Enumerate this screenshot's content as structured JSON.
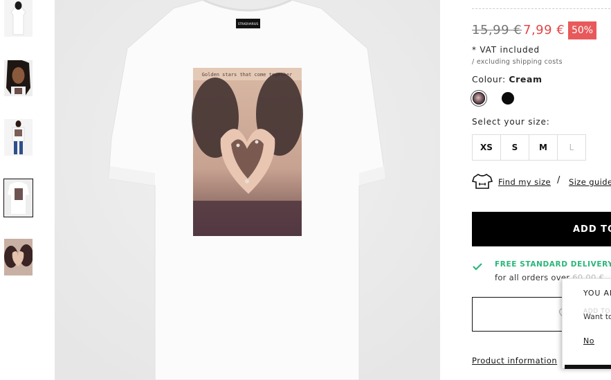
{
  "gallery": {
    "thumbnails": [
      "thumb-1",
      "thumb-2",
      "thumb-3",
      "thumb-4",
      "thumb-5"
    ],
    "selected_index": 3
  },
  "product": {
    "print_caption": "Golden stars that come together",
    "label_text": "STRADIVARIUS"
  },
  "price": {
    "old": "15,99 €",
    "new": "7,99 €",
    "discount": "50%",
    "vat": "* VAT included",
    "shipping_note": "/ excluding shipping costs"
  },
  "colour": {
    "label": "Colour:",
    "value": "Cream",
    "swatches": [
      "cream-print",
      "black"
    ]
  },
  "size": {
    "label": "Select your size:",
    "options": [
      "XS",
      "S",
      "M",
      "L"
    ],
    "unavailable": [
      "L"
    ],
    "find_my_size": "Find my size",
    "separator": "/",
    "size_guide": "Size guide"
  },
  "cart": {
    "add_label": "ADD TO"
  },
  "delivery": {
    "free_label": "FREE STANDARD DELIVERY ON",
    "for_all_orders": "for all orders over",
    "threshold": "60,00 €"
  },
  "product_info_link": "Product information",
  "popup": {
    "title": "YOU AR",
    "faded_text": "ADD TO",
    "want_text": "Want to",
    "no_label": "No"
  },
  "colors": {
    "price_red": "#e34547",
    "badge_red": "#e8595b",
    "delivery_green": "#2ab57a"
  }
}
